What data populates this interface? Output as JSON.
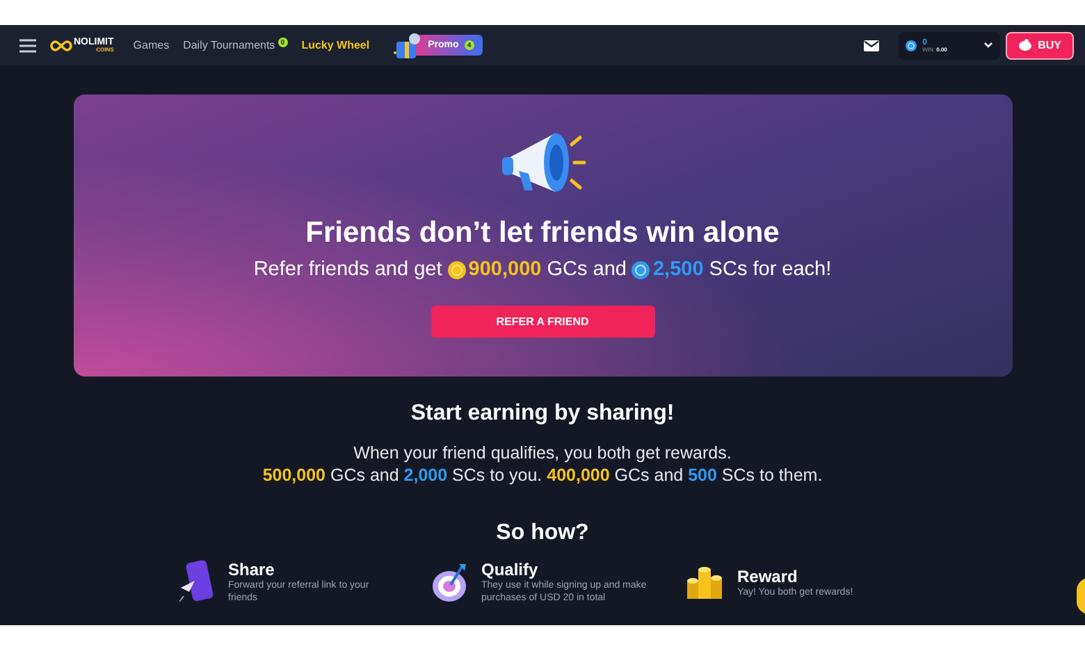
{
  "nav": {
    "logo": {
      "name": "NOLIMIT",
      "sub": "COINS"
    },
    "links": [
      {
        "label": "Games",
        "kind": "plain"
      },
      {
        "label": "Daily Tournaments",
        "kind": "badge",
        "badge": "0"
      },
      {
        "label": "Lucky Wheel",
        "kind": "highlight"
      }
    ],
    "promo": {
      "label": "Promo",
      "badge": "4"
    },
    "wallet": {
      "balance": "0",
      "win_label": "WIN:",
      "win": "0.00"
    },
    "buy": "BUY"
  },
  "hero": {
    "title": "Friends don’t let friends win alone",
    "subtitle": [
      {
        "text": "Refer friends and get ",
        "kind": "plain"
      },
      {
        "text": "900,000",
        "kind": "gc"
      },
      {
        "text": " GCs and ",
        "kind": "plain"
      },
      {
        "text": "2,500",
        "kind": "sc"
      },
      {
        "text": " SCs for each!",
        "kind": "plain"
      }
    ],
    "button": "REFER A FRIEND"
  },
  "earning": {
    "title": "Start earning by sharing!",
    "line1": "When your friend qualifies, you both get rewards.",
    "line2": [
      {
        "text": "500,000",
        "kind": "gc"
      },
      {
        "text": " GCs and ",
        "kind": "plain"
      },
      {
        "text": "2,000",
        "kind": "sc"
      },
      {
        "text": " SCs to you. ",
        "kind": "plain"
      },
      {
        "text": "400,000",
        "kind": "gc"
      },
      {
        "text": " GCs and ",
        "kind": "plain"
      },
      {
        "text": "500",
        "kind": "sc"
      },
      {
        "text": " SCs to them.",
        "kind": "plain"
      }
    ]
  },
  "how": {
    "title": "So how?",
    "steps": [
      {
        "kind": "share",
        "title": "Share",
        "text": "Forward your referral link to your friends"
      },
      {
        "kind": "qualify",
        "title": "Qualify",
        "text": "They use it while signing up and make purchases of USD 20 in total"
      },
      {
        "kind": "reward",
        "title": "Reward",
        "text": "Yay! You both get rewards!"
      }
    ]
  }
}
